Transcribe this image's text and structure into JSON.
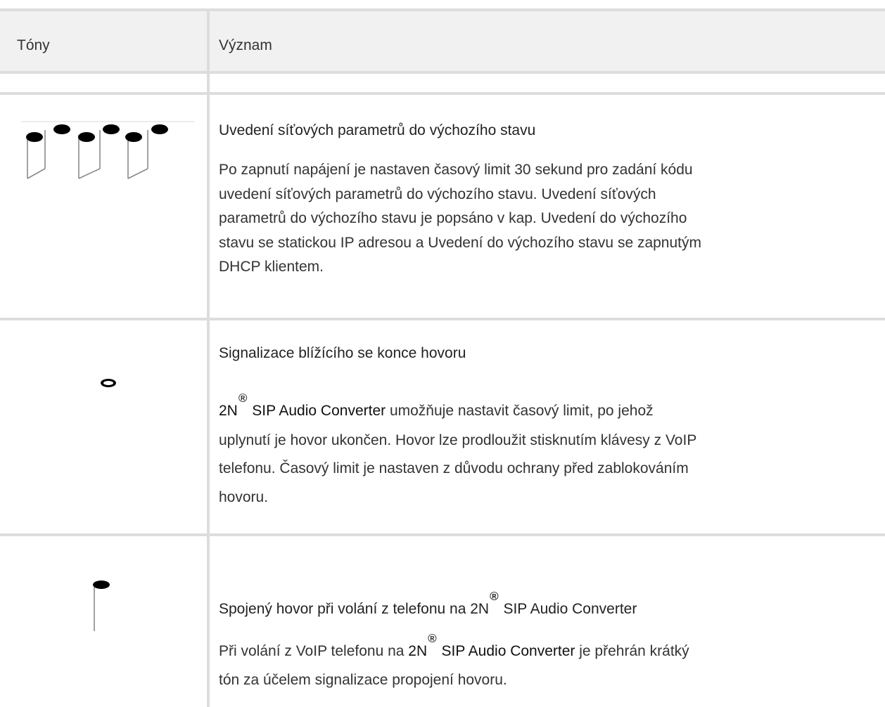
{
  "table": {
    "headers": {
      "tones": "Tóny",
      "meaning": "Význam"
    },
    "rows": [
      {
        "icon": "three-tones-icon",
        "title": "Uvedení síťových parametrů do výchozího stavu",
        "body": [
          "Po zapnutí napájení je nastaven časový limit 30 sekund pro zadání kódu",
          "uvedení síťových parametrů do výchozího stavu. Uvedení síťových",
          "parametrů do výchozího stavu je popsáno v kap. Uvedení do výchozího",
          "stavu se statickou IP adresou a Uvedení do výchozího stavu se zapnutým",
          "DHCP klientem."
        ]
      },
      {
        "icon": "whole-note-icon",
        "title": "Signalizace blížícího se konce hovoru",
        "brand_prefix": "2N",
        "reg_mark": "®",
        "brand_name": " SIP Audio Converter",
        "body_first_rest": " umožňuje nastavit časový limit, po jehož",
        "body": [
          "uplynutí je hovor ukončen. Hovor lze prodloužit stisknutím klávesy z VoIP",
          "telefonu. Časový limit je nastaven z důvodu ochrany před zablokováním",
          "hovoru."
        ]
      },
      {
        "icon": "single-note-icon",
        "title_prefix": "Spojený hovor při volání z telefonu na 2N",
        "reg_mark": "®",
        "title_suffix": " SIP Audio Converter",
        "body_first_prefix": "Při volání z VoIP telefonu na ",
        "brand_prefix": "2N",
        "brand_name": " SIP Audio Converter",
        "body_first_rest": " je přehrán krátký",
        "body": [
          "tón za účelem signalizace propojení hovoru."
        ]
      }
    ]
  }
}
